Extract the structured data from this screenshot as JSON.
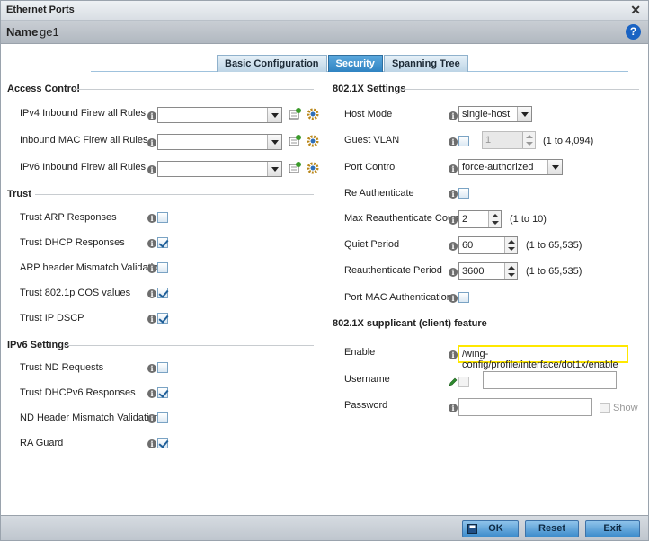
{
  "window": {
    "title": "Ethernet Ports"
  },
  "name": {
    "label": "Name",
    "value": "ge1"
  },
  "tabs": [
    {
      "label": "Basic Configuration",
      "active": false
    },
    {
      "label": "Security",
      "active": true
    },
    {
      "label": "Spanning Tree",
      "active": false
    }
  ],
  "access_control": {
    "heading": "Access Control",
    "rows": [
      {
        "label": "IPv4 Inbound Firew all Rules",
        "value": ""
      },
      {
        "label": "Inbound MAC Firew all Rules",
        "value": ""
      },
      {
        "label": "IPv6 Inbound Firew all Rules",
        "value": ""
      }
    ]
  },
  "trust": {
    "heading": "Trust",
    "rows": [
      {
        "label": "Trust ARP Responses",
        "checked": false
      },
      {
        "label": "Trust DHCP Responses",
        "checked": true
      },
      {
        "label": "ARP header Mismatch Validation",
        "checked": false
      },
      {
        "label": "Trust 802.1p COS values",
        "checked": true
      },
      {
        "label": "Trust IP DSCP",
        "checked": true
      }
    ]
  },
  "ipv6": {
    "heading": "IPv6 Settings",
    "rows": [
      {
        "label": "Trust ND Requests",
        "checked": false
      },
      {
        "label": "Trust DHCPv6 Responses",
        "checked": true
      },
      {
        "label": "ND Header Mismatch Validation",
        "checked": false
      },
      {
        "label": "RA Guard",
        "checked": true
      }
    ]
  },
  "dot1x": {
    "heading": "802.1X Settings",
    "host_mode": {
      "label": "Host Mode",
      "value": "single-host"
    },
    "guest_vlan": {
      "label": "Guest VLAN",
      "value": "1",
      "range": "(1 to 4,094)",
      "checked": false
    },
    "port_control": {
      "label": "Port Control",
      "value": "force-authorized"
    },
    "re_auth": {
      "label": "Re Authenticate",
      "checked": false
    },
    "max_reauth": {
      "label": "Max Reauthenticate Count",
      "value": "2",
      "range": "(1 to 10)"
    },
    "quiet": {
      "label": "Quiet Period",
      "value": "60",
      "range": "(1 to 65,535)"
    },
    "reauth_period": {
      "label": "Reauthenticate Period",
      "value": "3600",
      "range": "(1 to 65,535)"
    },
    "port_mac": {
      "label": "Port MAC Authentication",
      "checked": false
    }
  },
  "supplicant": {
    "heading": "802.1X supplicant (client) feature",
    "enable": {
      "label": "Enable",
      "value": "/wing-config/profile/interface/dot1x/enable"
    },
    "username": {
      "label": "Username",
      "value": ""
    },
    "password": {
      "label": "Password",
      "value": "",
      "show_label": "Show"
    }
  },
  "footer": {
    "ok": "OK",
    "reset": "Reset",
    "exit": "Exit"
  },
  "colors": {
    "accent": "#2f83c2",
    "highlight": "#ffe800",
    "help": "#1a63c3"
  }
}
